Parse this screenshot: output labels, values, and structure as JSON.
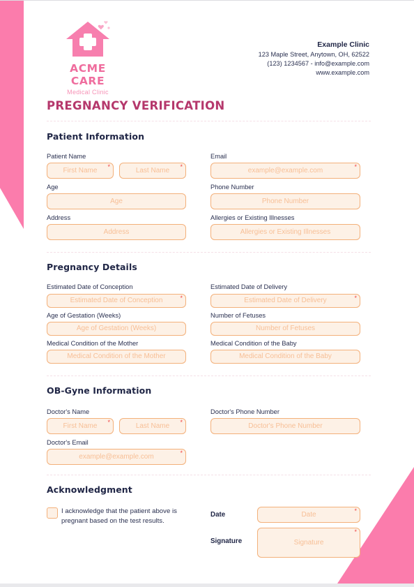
{
  "brand": {
    "logo_icon": "clinic-house-cross-icon",
    "name": "ACME CARE",
    "tagline": "Medical Clinic",
    "accent_pink": "#fb7cac",
    "title_color": "#b5386c"
  },
  "clinic": {
    "name": "Example Clinic",
    "address": "123 Maple Street, Anytown, OH, 62522",
    "contact": "(123) 1234567 - info@example.com",
    "website": "www.example.com"
  },
  "document": {
    "title": "PREGNANCY VERIFICATION"
  },
  "sections": {
    "patient": {
      "title": "Patient Information",
      "labels": {
        "patient_name": "Patient Name",
        "age": "Age",
        "address": "Address",
        "email": "Email",
        "phone": "Phone Number",
        "allergies": "Allergies or Existing Illnesses"
      },
      "placeholders": {
        "first_name": "First Name",
        "last_name": "Last Name",
        "age": "Age",
        "address": "Address",
        "email": "example@example.com",
        "phone": "Phone Number",
        "allergies": "Allergies or Existing Illnesses"
      }
    },
    "pregnancy": {
      "title": "Pregnancy Details",
      "labels": {
        "conception": "Estimated Date of Conception",
        "gestation": "Age of Gestation (Weeks)",
        "mother_condition": "Medical Condition of the Mother",
        "delivery": "Estimated Date of Delivery",
        "fetuses": "Number of Fetuses",
        "baby_condition": "Medical Condition of the Baby"
      },
      "placeholders": {
        "conception": "Estimated Date of Conception",
        "gestation": "Age of Gestation (Weeks)",
        "mother_condition": "Medical Condition of the Mother",
        "delivery": "Estimated Date of Delivery",
        "fetuses": "Number of Fetuses",
        "baby_condition": "Medical Condition of the Baby"
      }
    },
    "obgyne": {
      "title": "OB-Gyne Information",
      "labels": {
        "doctor_name": "Doctor's Name",
        "doctor_email": "Doctor's Email",
        "doctor_phone": "Doctor's Phone Number"
      },
      "placeholders": {
        "first_name": "First Name",
        "last_name": "Last Name",
        "doctor_email": "example@example.com",
        "doctor_phone": "Doctor's Phone Number"
      }
    },
    "acknowledgment": {
      "title": "Acknowledgment",
      "statement": "I acknowledge that the patient above is pregnant based on the test results.",
      "date_label": "Date",
      "signature_label": "Signature",
      "placeholders": {
        "date": "Date",
        "signature": "Signature"
      }
    }
  },
  "required_marker": "*"
}
